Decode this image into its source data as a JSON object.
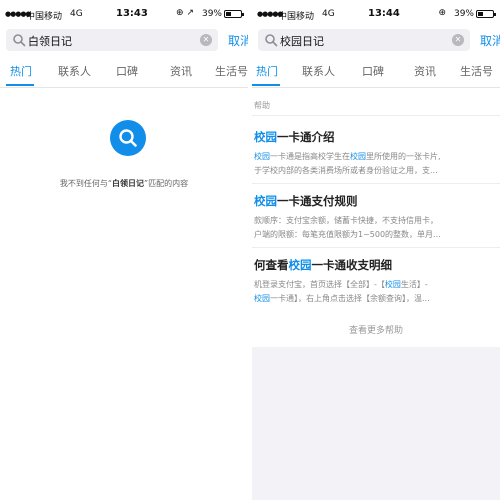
{
  "colors": {
    "accent": "#108ee9",
    "bg_gray": "#f2f2f7"
  },
  "left": {
    "status": {
      "carrier": "中国移动",
      "network": "4G",
      "time": "13:43",
      "icons": "⊕ ↗",
      "battery": "39%"
    },
    "search": {
      "value": "白领日记",
      "cancel": "取消"
    },
    "tabs": [
      "热门",
      "联系人",
      "口碑",
      "资讯",
      "生活号"
    ],
    "empty": {
      "prefix": "我不到任何与“",
      "keyword": "白领日记",
      "suffix": "”匹配的内容"
    }
  },
  "right": {
    "status": {
      "carrier": "中国移动",
      "network": "4G",
      "time": "13:44",
      "icons": "⊕",
      "battery": "39%"
    },
    "search": {
      "value": "校园日记",
      "cancel": "取消"
    },
    "tabs": [
      "热门",
      "联系人",
      "口碑",
      "资讯",
      "生活号"
    ],
    "section_label": "帮助",
    "items": [
      {
        "title_hl": "校园",
        "title_rest": "一卡通介绍",
        "line1_a": "校园",
        "line1_b": "一卡通是指高校学生在",
        "line1_c": "校园",
        "line1_d": "里所使用的一张卡片,",
        "line2": "于学校内部的各类消费场所或者身份验证之用，支..."
      },
      {
        "title_hl": "校园",
        "title_rest": "一卡通支付规则",
        "line1": "款顺序：支付宝余额，储蓄卡快捷，不支持信用卡，",
        "line2": "户端的限额：每笔充值限额为1~500的整数，单月..."
      },
      {
        "title_a": "何查看",
        "title_hl": "校园",
        "title_rest": "一卡通收支明细",
        "line1_a": "机登录支付宝，首页选择【全部】-【",
        "line1_hl": "校园",
        "line1_b": "生活】-",
        "line2_a": "校园",
        "line2_b": "一卡通】，右上角点击选择【余额查询】，温..."
      }
    ],
    "more": "查看更多帮助"
  }
}
